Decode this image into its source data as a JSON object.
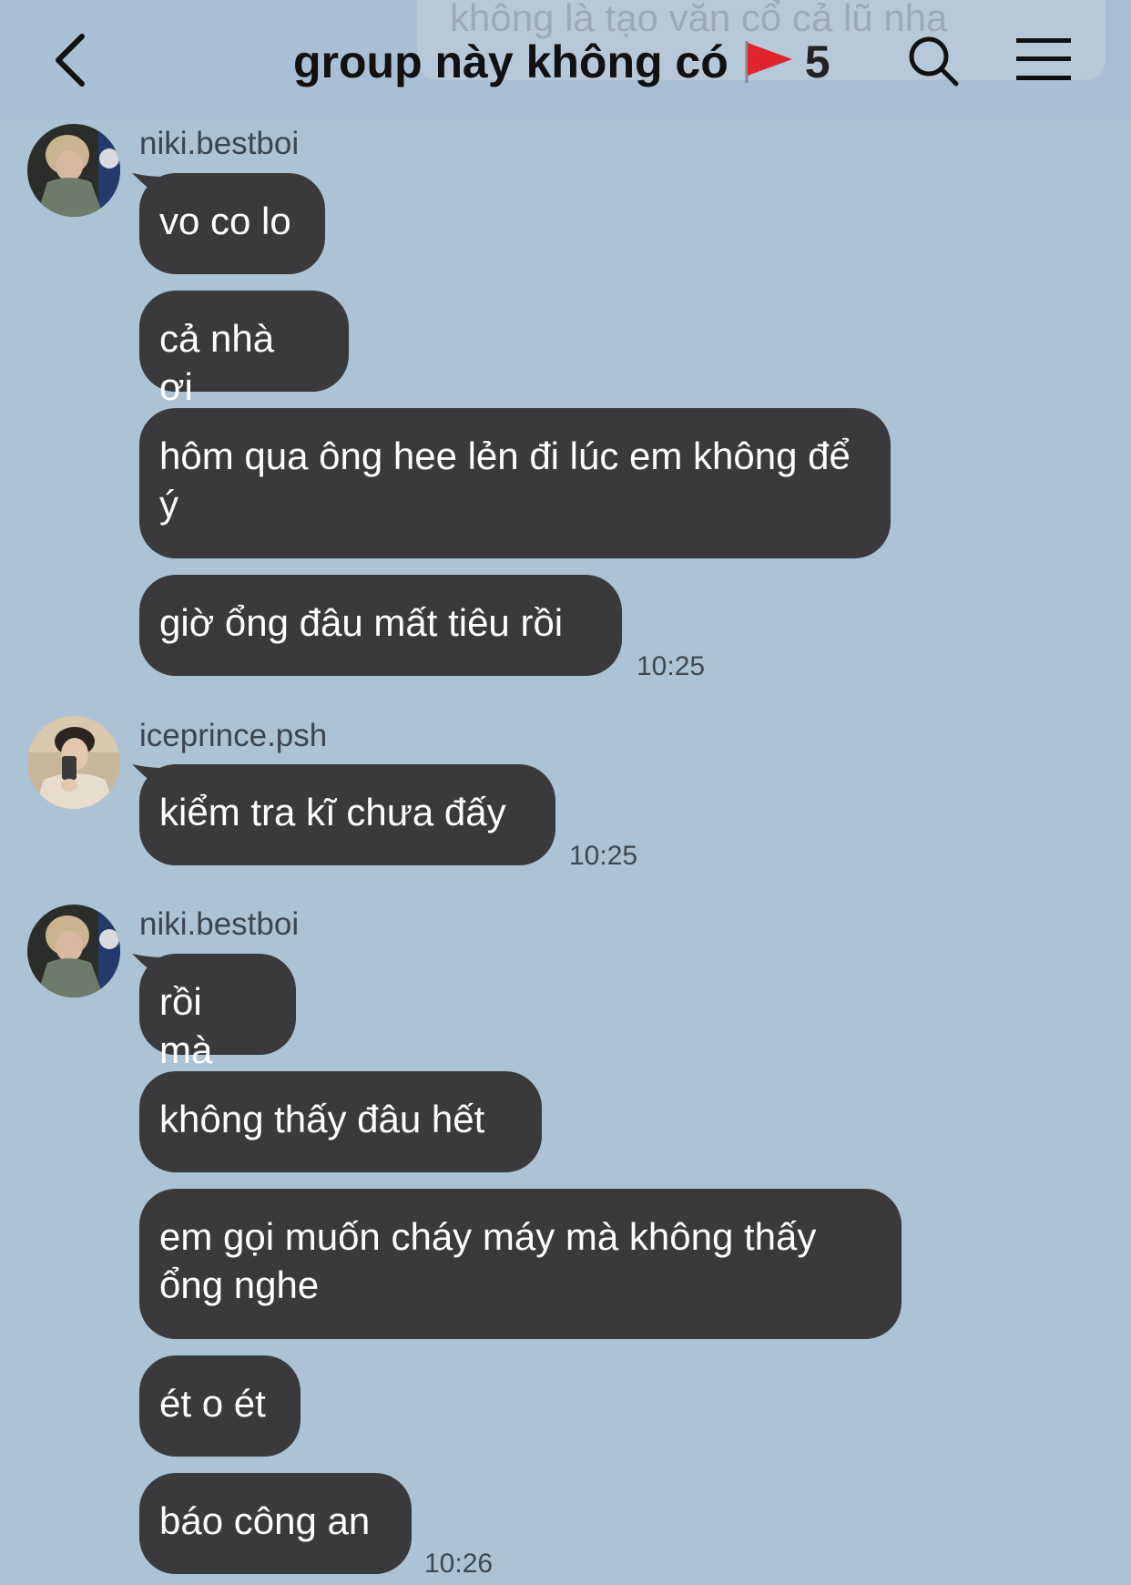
{
  "header": {
    "title": "group này không có",
    "member_count": "5",
    "background_preview": "không là tạo văn cổ cả lũ nha",
    "icons": {
      "back": "chevron-left-icon",
      "flag": "red-flag-icon",
      "search": "search-icon",
      "menu": "hamburger-menu-icon"
    }
  },
  "messages": {
    "g1": {
      "username": "niki.bestboi",
      "b1": "vo co lo",
      "b2": "cả nhà ơi",
      "b3": "hôm qua ông hee lẻn đi lúc em không để ý",
      "b4": "giờ ổng đâu mất tiêu rồi",
      "time": "10:25"
    },
    "g2": {
      "username": "iceprince.psh",
      "b1": "kiểm tra kĩ chưa đấy",
      "time": "10:25"
    },
    "g3": {
      "username": "niki.bestboi",
      "b1": "rồi mà",
      "b2": "không thấy đâu hết",
      "b3": "em gọi muốn cháy máy mà không thấy ổng nghe",
      "b4": "ét o ét",
      "b5": "báo công an",
      "time": "10:26"
    }
  },
  "colors": {
    "background": "#abc3d4",
    "bubble": "#3a3a3c",
    "bubble_text": "#ffffff",
    "flag": "#e0242c"
  }
}
